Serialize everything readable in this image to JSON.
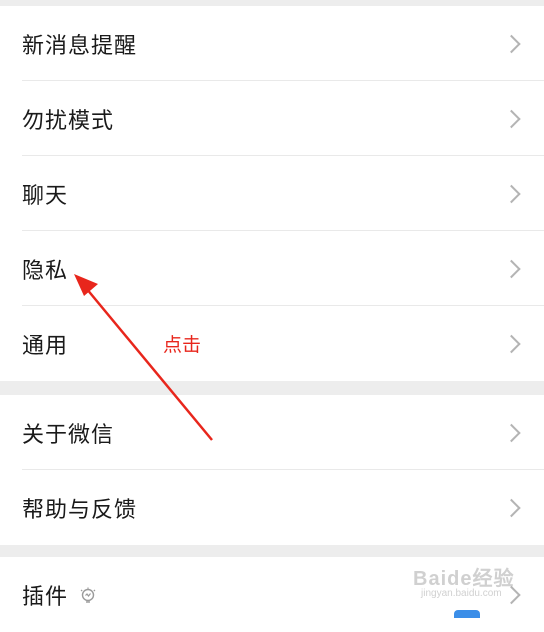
{
  "settings": {
    "items": [
      {
        "label": "新消息提醒"
      },
      {
        "label": "勿扰模式"
      },
      {
        "label": "聊天"
      },
      {
        "label": "隐私"
      },
      {
        "label": "通用"
      },
      {
        "label": "关于微信"
      },
      {
        "label": "帮助与反馈"
      },
      {
        "label": "插件"
      }
    ]
  },
  "annotation": {
    "text": "点击",
    "color": "#e8261c"
  },
  "watermark": {
    "main": "Baide经验",
    "sub": "jingyan.baidu.com"
  },
  "icons": {
    "chevron": "chevron-right-icon",
    "plugin": "lightbulb-icon"
  }
}
